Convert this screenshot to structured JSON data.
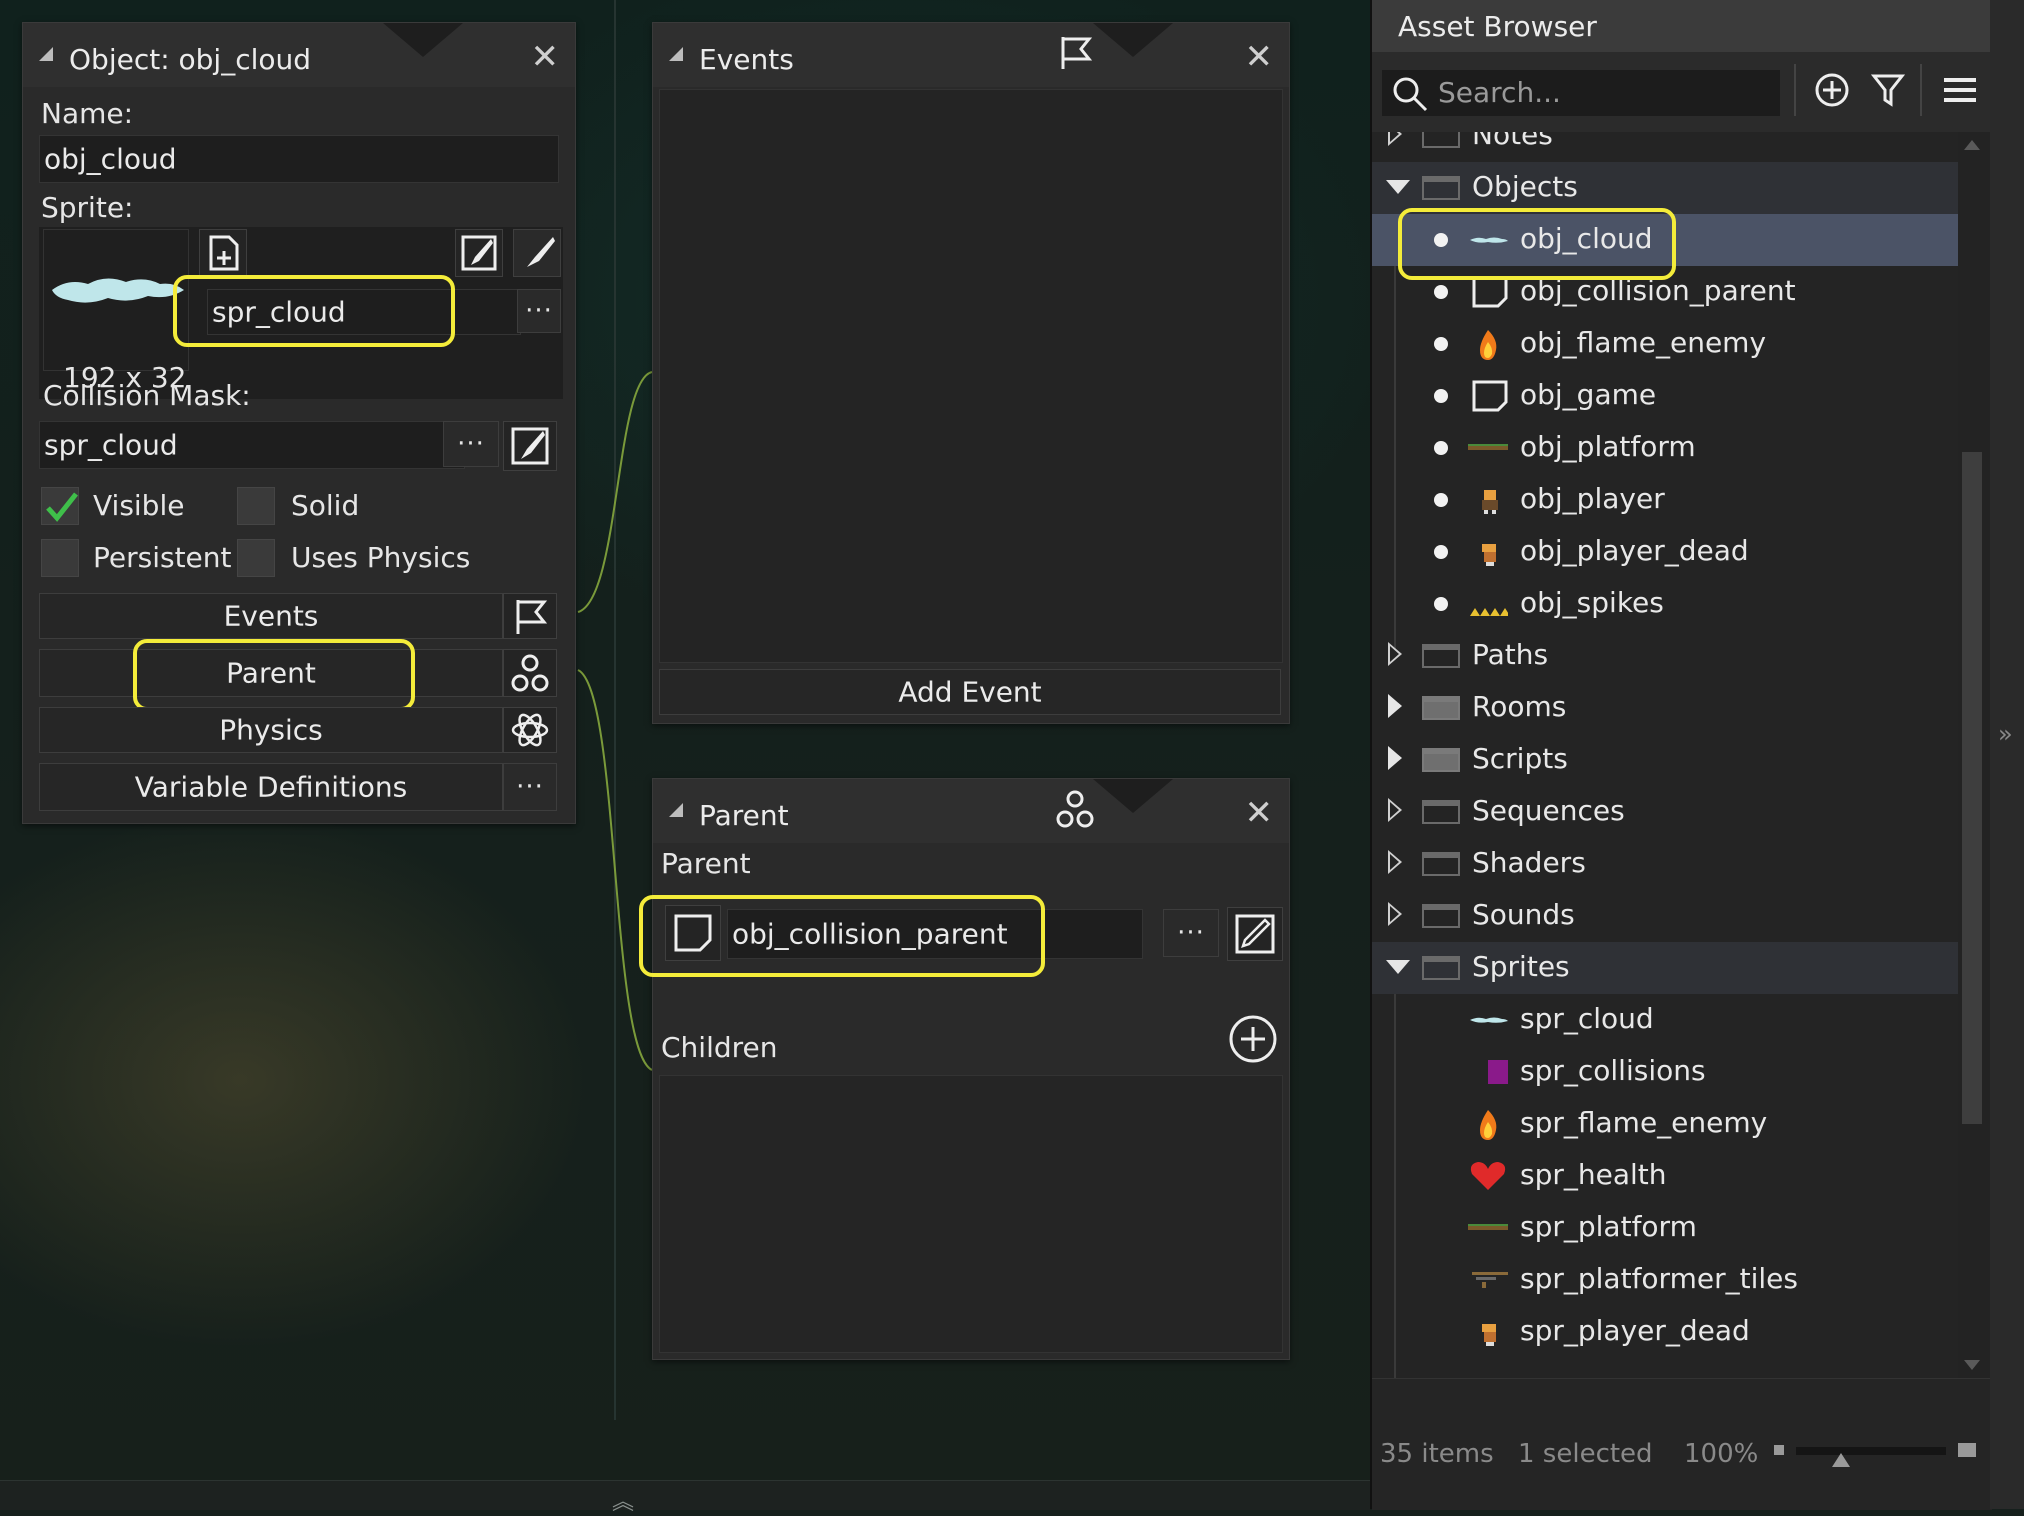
{
  "object_panel": {
    "title": "Object: obj_cloud",
    "name_label": "Name:",
    "name_value": "obj_cloud",
    "sprite_label": "Sprite:",
    "sprite_value": "spr_cloud",
    "sprite_size": "192 x 32",
    "collision_label": "Collision Mask:",
    "collision_value": "spr_cloud",
    "checkboxes": [
      {
        "label": "Visible",
        "checked": true
      },
      {
        "label": "Solid",
        "checked": false
      },
      {
        "label": "Persistent",
        "checked": false
      },
      {
        "label": "Uses Physics",
        "checked": false
      }
    ],
    "buttons": {
      "events": "Events",
      "parent": "Parent",
      "physics": "Physics",
      "variables": "Variable Definitions"
    },
    "dots": "···"
  },
  "events_panel": {
    "title": "Events",
    "add_event": "Add Event"
  },
  "parent_panel": {
    "title": "Parent",
    "parent_label": "Parent",
    "parent_value": "obj_collision_parent",
    "children_label": "Children",
    "dots": "···"
  },
  "asset_browser": {
    "title": "Asset Browser",
    "search_placeholder": "Search...",
    "rows": [
      {
        "name": "Notes",
        "kind": "folder-closed"
      },
      {
        "name": "Objects",
        "kind": "folder-open"
      },
      {
        "name": "obj_cloud",
        "kind": "object",
        "icon": "cloud-sprite-icon",
        "selected": true
      },
      {
        "name": "obj_collision_parent",
        "kind": "object",
        "icon": "empty-object-icon"
      },
      {
        "name": "obj_flame_enemy",
        "kind": "object",
        "icon": "flame-icon"
      },
      {
        "name": "obj_game",
        "kind": "object",
        "icon": "empty-object-icon"
      },
      {
        "name": "obj_platform",
        "kind": "object",
        "icon": "platform-sprite-icon"
      },
      {
        "name": "obj_player",
        "kind": "object",
        "icon": "player-sprite-icon"
      },
      {
        "name": "obj_player_dead",
        "kind": "object",
        "icon": "player-dead-sprite-icon"
      },
      {
        "name": "obj_spikes",
        "kind": "object",
        "icon": "spikes-sprite-icon"
      },
      {
        "name": "Paths",
        "kind": "folder-closed"
      },
      {
        "name": "Rooms",
        "kind": "folder-closed-filled"
      },
      {
        "name": "Scripts",
        "kind": "folder-closed-filled"
      },
      {
        "name": "Sequences",
        "kind": "folder-closed"
      },
      {
        "name": "Shaders",
        "kind": "folder-closed"
      },
      {
        "name": "Sounds",
        "kind": "folder-closed"
      },
      {
        "name": "Sprites",
        "kind": "folder-open"
      },
      {
        "name": "spr_cloud",
        "kind": "sprite",
        "icon": "cloud-sprite-icon"
      },
      {
        "name": "spr_collisions",
        "kind": "sprite",
        "icon": "purple-square-icon"
      },
      {
        "name": "spr_flame_enemy",
        "kind": "sprite",
        "icon": "flame-icon"
      },
      {
        "name": "spr_health",
        "kind": "sprite",
        "icon": "heart-icon"
      },
      {
        "name": "spr_platform",
        "kind": "sprite",
        "icon": "platform-sprite-icon"
      },
      {
        "name": "spr_platformer_tiles",
        "kind": "sprite",
        "icon": "tiles-sprite-icon"
      },
      {
        "name": "spr_player_dead",
        "kind": "sprite",
        "icon": "player-dead-sprite-icon"
      }
    ],
    "footer": {
      "items": "35 items",
      "selected": "1 selected",
      "zoom": "100%"
    }
  },
  "colors": {
    "highlight": "#f4ec3a",
    "selection": "#4b5366",
    "link_line": "#7a9a3a",
    "checkmark": "#3fbf4a"
  }
}
